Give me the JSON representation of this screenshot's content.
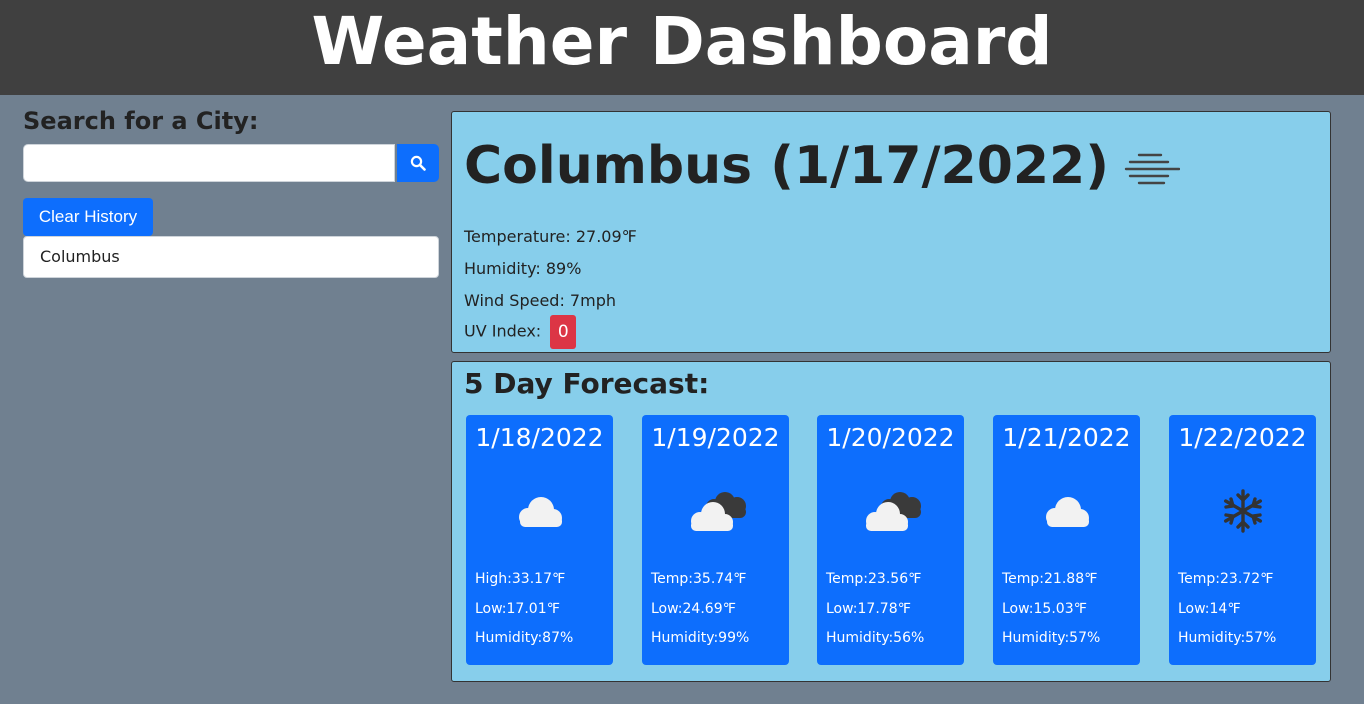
{
  "header": {
    "title": "Weather Dashboard"
  },
  "sidebar": {
    "heading": "Search for a City:",
    "search": {
      "value": "",
      "placeholder": ""
    },
    "clear_label": "Clear History",
    "history": [
      "Columbus"
    ]
  },
  "current": {
    "title": "Columbus (1/17/2022)",
    "icon": "fog-icon",
    "temperature": "Temperature: 27.09℉",
    "humidity": "Humidity: 89%",
    "wind": "Wind Speed: 7mph",
    "uv_label": "UV Index:",
    "uv_value": "0"
  },
  "forecast": {
    "heading": "5 Day Forecast:",
    "days": [
      {
        "date": "1/18/2022",
        "icon": "cloud-icon",
        "line1": "High:33.17℉",
        "line2": "Low:17.01℉",
        "line3": "Humidity:87%"
      },
      {
        "date": "1/19/2022",
        "icon": "broken-clouds-icon",
        "line1": "Temp:35.74℉",
        "line2": "Low:24.69℉",
        "line3": "Humidity:99%"
      },
      {
        "date": "1/20/2022",
        "icon": "broken-clouds-icon",
        "line1": "Temp:23.56℉",
        "line2": "Low:17.78℉",
        "line3": "Humidity:56%"
      },
      {
        "date": "1/21/2022",
        "icon": "cloud-icon",
        "line1": "Temp:21.88℉",
        "line2": "Low:15.03℉",
        "line3": "Humidity:57%"
      },
      {
        "date": "1/22/2022",
        "icon": "snow-icon",
        "line1": "Temp:23.72℉",
        "line2": "Low:14℉",
        "line3": "Humidity:57%"
      }
    ]
  },
  "colors": {
    "page_bg": "#708090",
    "header_bg": "#404040",
    "panel_bg": "#87ceeb",
    "card_bg": "#0d6efd",
    "uv_badge": "#dc3545"
  }
}
